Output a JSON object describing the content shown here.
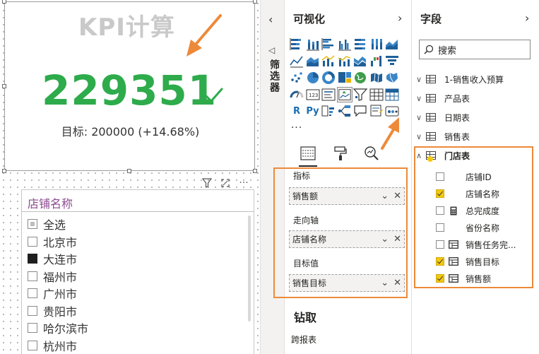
{
  "kpi": {
    "title": "KPI计算",
    "value": "229351",
    "goal_text": "目标: 200000 (+14.68%)",
    "value_color": "#2eab4b",
    "status_icon": "check-icon"
  },
  "slicer": {
    "title": "店铺名称",
    "items": [
      {
        "label": "全选",
        "state": "partial"
      },
      {
        "label": "北京市",
        "state": "unchecked"
      },
      {
        "label": "大连市",
        "state": "checked"
      },
      {
        "label": "福州市",
        "state": "unchecked"
      },
      {
        "label": "广州市",
        "state": "unchecked"
      },
      {
        "label": "贵阳市",
        "state": "unchecked"
      },
      {
        "label": "哈尔滨市",
        "state": "unchecked"
      },
      {
        "label": "杭州市",
        "state": "unchecked"
      }
    ]
  },
  "filters": {
    "label": "筛选器"
  },
  "visualizations": {
    "header": "可视化",
    "selected_visual": "kpi-visual",
    "wells": [
      {
        "label": "指标",
        "value": "销售额"
      },
      {
        "label": "走向轴",
        "value": "店铺名称"
      },
      {
        "label": "目标值",
        "value": "销售目标"
      }
    ],
    "drill_title": "钻取",
    "drill_sub": "跨报表"
  },
  "fields": {
    "header": "字段",
    "search_placeholder": "搜索",
    "tables": [
      {
        "name": "1-销售收入预算",
        "expanded": false
      },
      {
        "name": "产品表",
        "expanded": false
      },
      {
        "name": "日期表",
        "expanded": false
      },
      {
        "name": "销售表",
        "expanded": false
      },
      {
        "name": "门店表",
        "expanded": true
      }
    ],
    "store_fields": [
      {
        "label": "店铺ID",
        "checked": false,
        "icon": "none"
      },
      {
        "label": "店铺名称",
        "checked": true,
        "icon": "none"
      },
      {
        "label": "总完成度",
        "checked": false,
        "icon": "calculator-icon"
      },
      {
        "label": "省份名称",
        "checked": false,
        "icon": "none"
      },
      {
        "label": "销售任务完...",
        "checked": false,
        "icon": "table-icon"
      },
      {
        "label": "销售目标",
        "checked": true,
        "icon": "table-icon"
      },
      {
        "label": "销售额",
        "checked": true,
        "icon": "table-icon"
      }
    ]
  },
  "colors": {
    "accent_orange": "#ec8a3a",
    "kpi_green": "#2eab4b",
    "slicer_title": "#8a4a8f",
    "check_yellow": "#f2c811"
  }
}
